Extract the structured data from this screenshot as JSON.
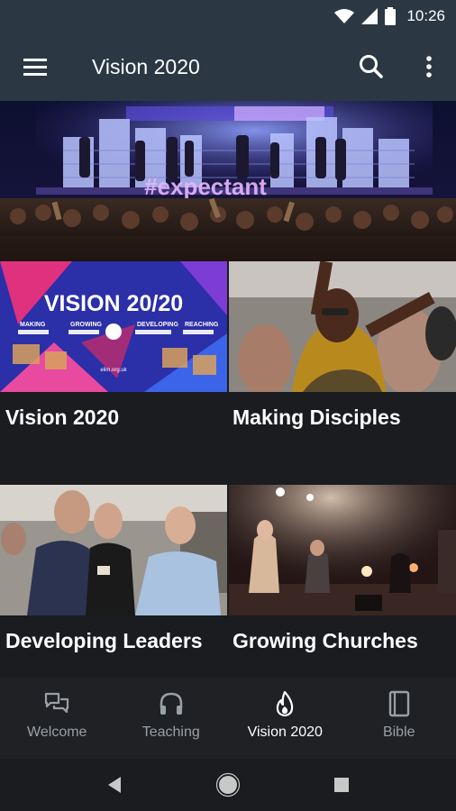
{
  "status_bar": {
    "time": "10:26"
  },
  "app_bar": {
    "title": "Vision 2020"
  },
  "hero": {
    "banner_text": "#expectant"
  },
  "tiles": [
    {
      "label": "Vision 2020",
      "poster_title": "VISION 20/20",
      "poster_items": [
        "MAKING",
        "GROWING",
        "DEVELOPING",
        "REACHING"
      ],
      "poster_url": "elim.org.uk"
    },
    {
      "label": "Making Disciples"
    },
    {
      "label": "Developing Leaders"
    },
    {
      "label": "Growing Churches"
    }
  ],
  "bottom_nav": {
    "items": [
      {
        "label": "Welcome",
        "icon": "chat-bubbles-icon"
      },
      {
        "label": "Teaching",
        "icon": "headphones-icon"
      },
      {
        "label": "Vision 2020",
        "icon": "flame-icon",
        "active": true
      },
      {
        "label": "Bible",
        "icon": "book-icon"
      }
    ]
  },
  "colors": {
    "app_bar": "#2b3844",
    "background": "#1a1c1f",
    "nav_inactive": "#9aa0a6",
    "nav_active": "#ffffff"
  }
}
